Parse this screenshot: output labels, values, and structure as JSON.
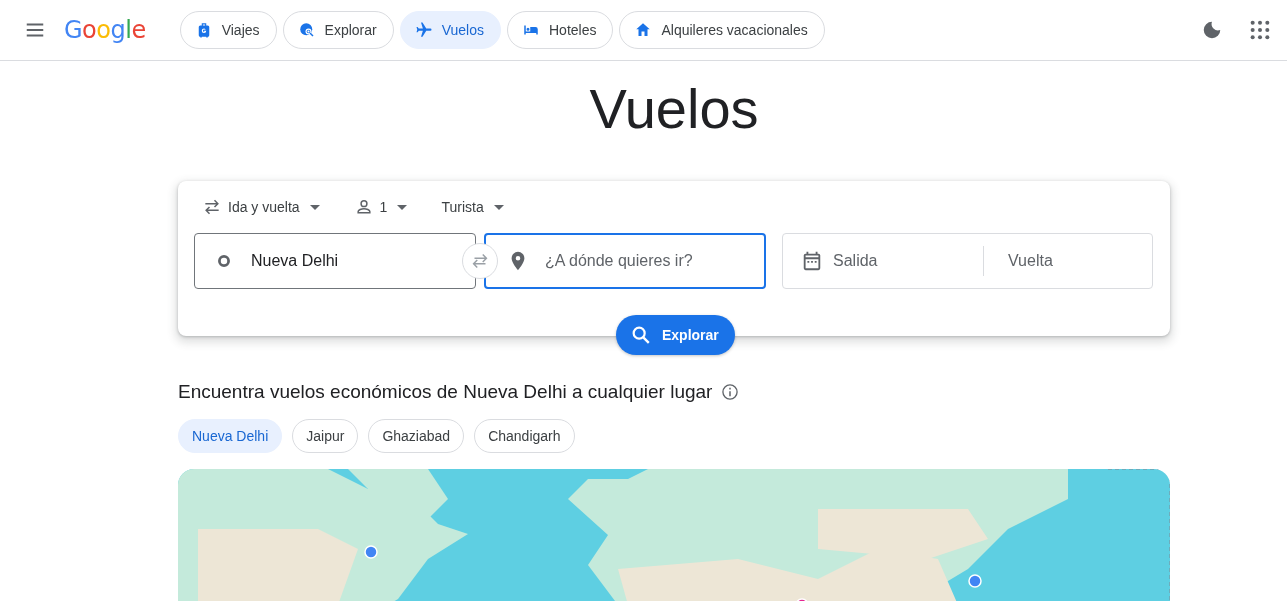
{
  "header": {
    "logo": "Google",
    "nav": [
      {
        "label": "Viajes",
        "selected": false
      },
      {
        "label": "Explorar",
        "selected": false
      },
      {
        "label": "Vuelos",
        "selected": true
      },
      {
        "label": "Hoteles",
        "selected": false
      },
      {
        "label": "Alquileres vacacionales",
        "selected": false
      }
    ]
  },
  "title": "Vuelos",
  "search": {
    "trip_type": "Ida y vuelta",
    "passengers": "1",
    "cabin": "Turista",
    "origin": {
      "value": "Nueva Delhi"
    },
    "destination": {
      "placeholder": "¿A dónde quieres ir?",
      "focused": true
    },
    "departure": {
      "placeholder": "Salida"
    },
    "return": {
      "placeholder": "Vuelta"
    },
    "button": "Explorar"
  },
  "explore": {
    "heading": "Encuentra vuelos económicos de Nueva Delhi a cualquier lugar",
    "chips": [
      {
        "label": "Nueva Delhi",
        "selected": true
      },
      {
        "label": "Jaipur",
        "selected": false
      },
      {
        "label": "Ghaziabad",
        "selected": false
      },
      {
        "label": "Chandigarh",
        "selected": false
      }
    ]
  }
}
